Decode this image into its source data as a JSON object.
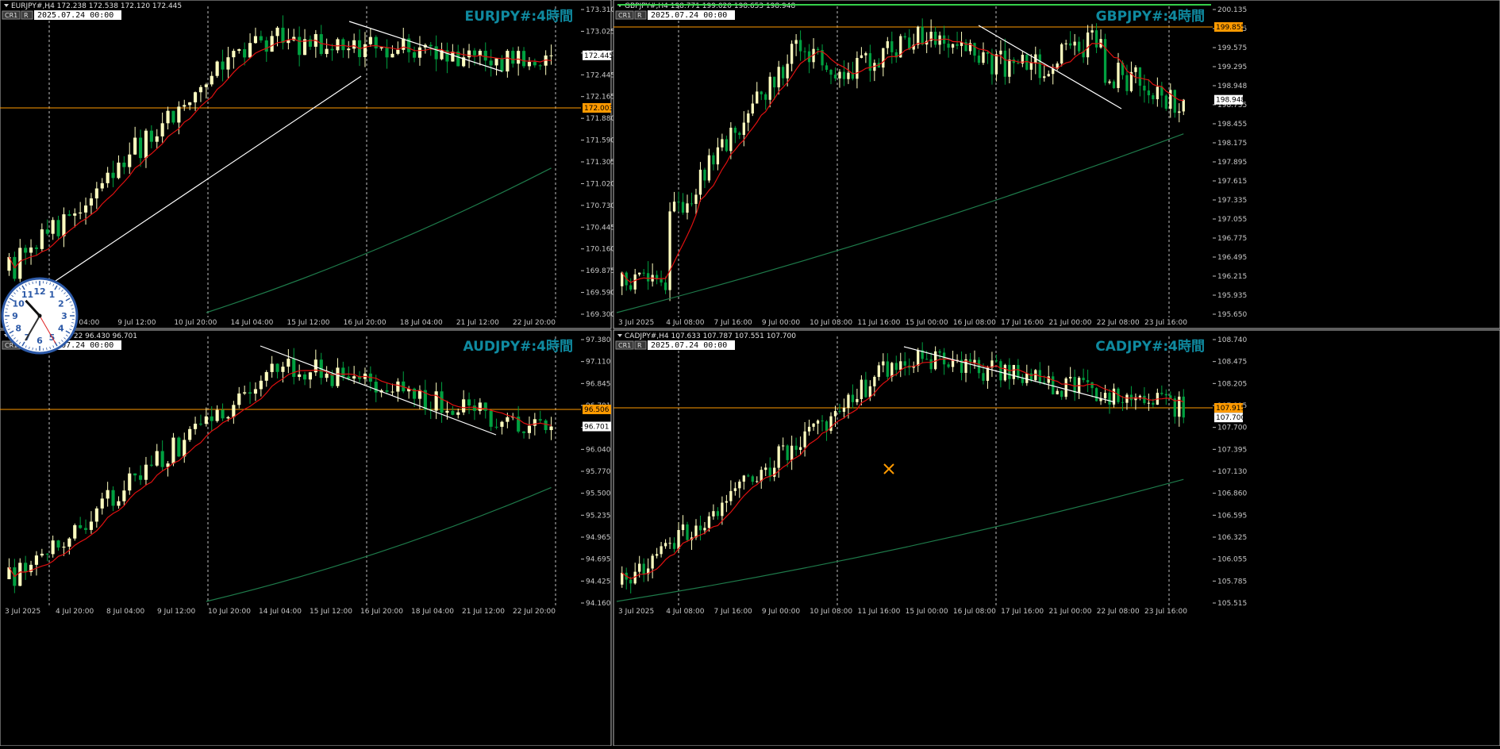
{
  "panes": [
    {
      "id": "eurjpy",
      "header": "EURJPY#,H4  172.238 172.538 172.120 172.445",
      "badges": [
        "CR1",
        "R"
      ],
      "datebox": "2025.07.24 00:00",
      "watermark": "EURJPY#:4時間",
      "ylabels": [
        "173.310",
        "173.025",
        "172.740",
        "172.445",
        "172.165",
        "171.880",
        "171.590",
        "171.305",
        "171.020",
        "170.730",
        "170.445",
        "170.160",
        "169.875",
        "169.590",
        "169.300"
      ],
      "xlabels": [
        "7 Jul 2025",
        "8 Jul 04:00",
        "9 Jul 12:00",
        "10 Jul 20:00",
        "14 Jul 04:00",
        "15 Jul 12:00",
        "16 Jul 20:00",
        "18 Jul 04:00",
        "21 Jul 12:00",
        "22 Jul 20:00"
      ],
      "price_tag": "172.445",
      "level_tag": "172.003",
      "colors": {
        "bull": "#ffffc0",
        "bear": "#00a040",
        "ma_fast": "#e01010",
        "ma_slow": "#1e7a4a",
        "level": "#ff9a00",
        "trend": "#ffffff"
      }
    },
    {
      "id": "gbpjpy",
      "header": "GBPJPY#,H4  198.771 199.020 198.653 198.948",
      "badges": [
        "CR1",
        "R"
      ],
      "datebox": "2025.07.24 00:00",
      "watermark": "GBPJPY#:4時間",
      "ylabels": [
        "200.135",
        "199.855",
        "199.575",
        "199.295",
        "198.948",
        "198.735",
        "198.455",
        "198.175",
        "197.895",
        "197.615",
        "197.335",
        "197.055",
        "196.775",
        "196.495",
        "196.215",
        "195.935",
        "195.650"
      ],
      "xlabels": [
        "3 Jul 2025",
        "4 Jul 08:00",
        "7 Jul 16:00",
        "9 Jul 00:00",
        "10 Jul 08:00",
        "11 Jul 16:00",
        "15 Jul 00:00",
        "16 Jul 08:00",
        "17 Jul 16:00",
        "21 Jul 00:00",
        "22 Jul 08:00",
        "23 Jul 16:00"
      ],
      "price_tag": "198.948",
      "level_tag": "199.855"
    },
    {
      "id": "audjpy",
      "header": "AUDJPY#,H4  96.722 96.430 96.701",
      "badges": [
        "CR1",
        "R"
      ],
      "datebox": "2025.07.24 00:00",
      "watermark": "AUDJPY#:4時間",
      "ylabels": [
        "97.380",
        "97.110",
        "96.845",
        "96.701",
        "96.305",
        "96.040",
        "95.770",
        "95.500",
        "95.235",
        "94.965",
        "94.695",
        "94.425",
        "94.160"
      ],
      "xlabels": [
        "3 Jul 2025",
        "4 Jul 20:00",
        "8 Jul 04:00",
        "9 Jul 12:00",
        "10 Jul 20:00",
        "14 Jul 04:00",
        "15 Jul 12:00",
        "16 Jul 20:00",
        "18 Jul 04:00",
        "21 Jul 12:00",
        "22 Jul 20:00"
      ],
      "price_tag": "96.701",
      "level_tag": "96.506"
    },
    {
      "id": "cadjpy",
      "header": "CADJPY#,H4  107.633 107.787 107.551 107.700",
      "badges": [
        "CR1",
        "R"
      ],
      "datebox": "2025.07.24 00:00",
      "watermark": "CADJPY#:4時間",
      "ylabels": [
        "108.740",
        "108.475",
        "108.205",
        "107.915",
        "107.700",
        "107.395",
        "107.130",
        "106.860",
        "106.595",
        "106.325",
        "106.055",
        "105.785",
        "105.515"
      ],
      "xlabels": [
        "3 Jul 2025",
        "4 Jul 08:00",
        "7 Jul 16:00",
        "9 Jul 00:00",
        "10 Jul 08:00",
        "11 Jul 16:00",
        "15 Jul 00:00",
        "16 Jul 08:00",
        "17 Jul 16:00",
        "21 Jul 00:00",
        "22 Jul 08:00",
        "23 Jul 16:00"
      ],
      "price_tag": "107.700",
      "level_tag": "107.915"
    }
  ],
  "clock": {
    "numbers": [
      "12",
      "1",
      "2",
      "3",
      "4",
      "5",
      "6",
      "7",
      "8",
      "9",
      "10",
      "11"
    ],
    "hour": 10,
    "minute": 35,
    "second": 25
  }
}
